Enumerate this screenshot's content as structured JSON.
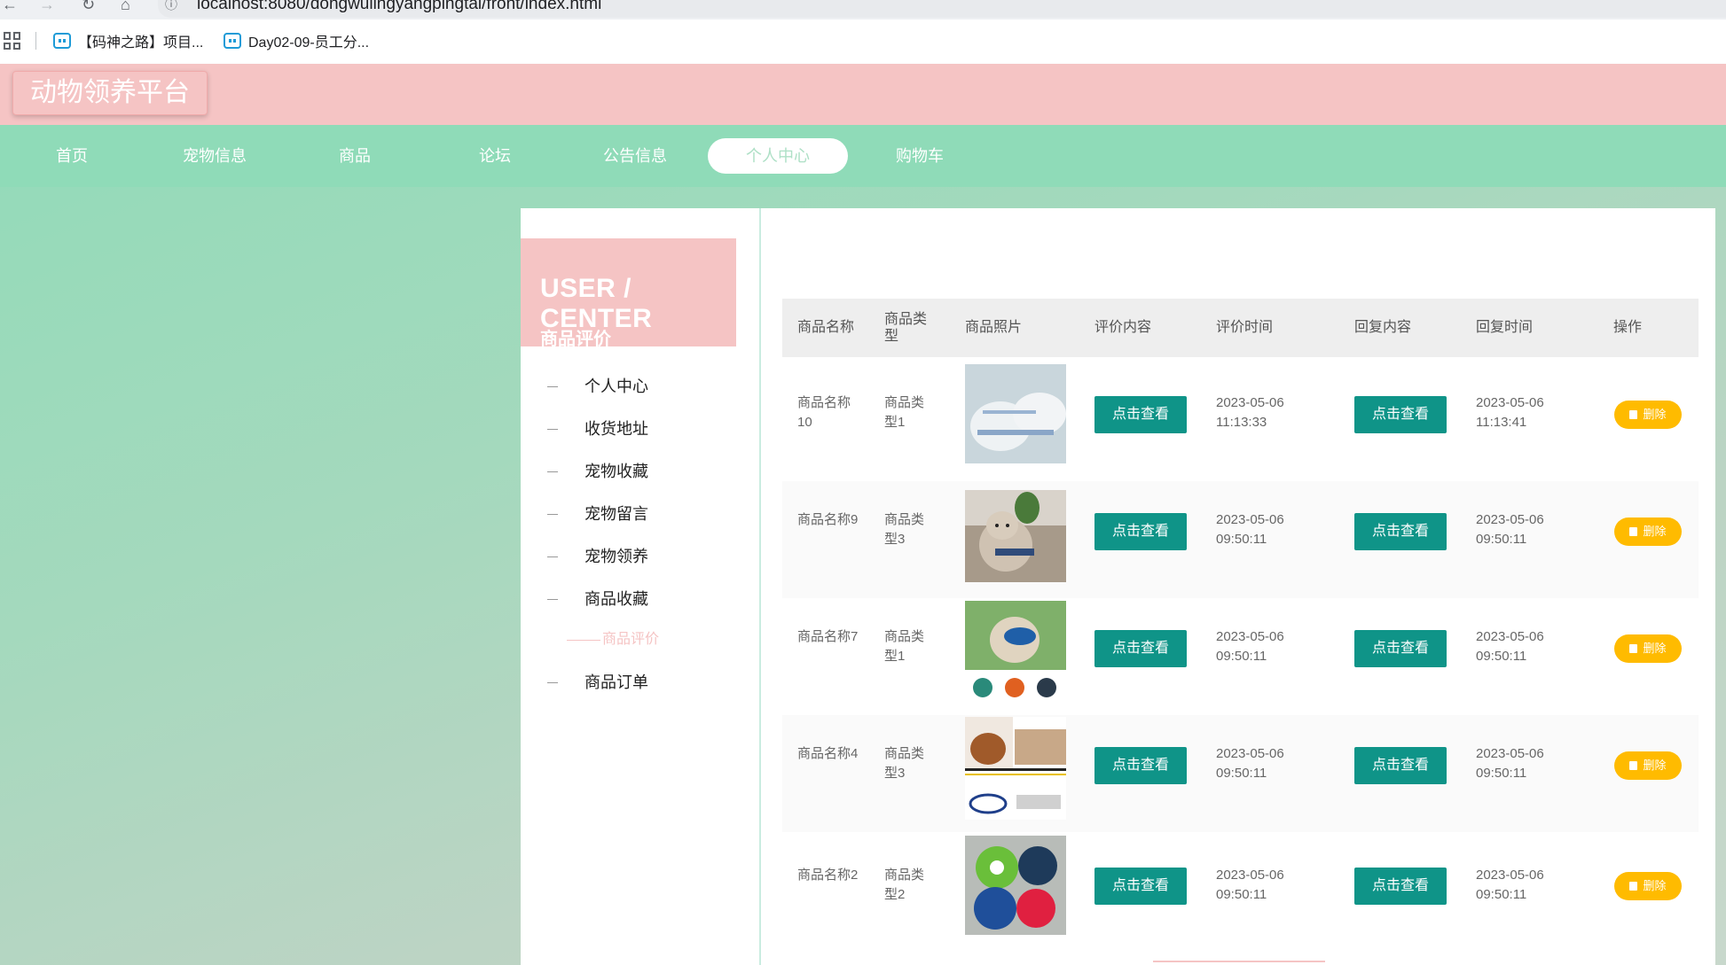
{
  "browser": {
    "url": "localhost:8080/dongwulingyangpingtai/front/index.html",
    "bookmarks": [
      {
        "label": "【码神之路】项目..."
      },
      {
        "label": "Day02-09-员工分..."
      }
    ]
  },
  "site": {
    "logo": "动物领养平台"
  },
  "nav": {
    "items": [
      {
        "label": "首页"
      },
      {
        "label": "宠物信息"
      },
      {
        "label": "商品"
      },
      {
        "label": "论坛"
      },
      {
        "label": "公告信息"
      },
      {
        "label": "个人中心",
        "active": true
      },
      {
        "label": "购物车"
      }
    ]
  },
  "sidebar": {
    "title": "USER / CENTER",
    "subtitle": "商品评价",
    "items": [
      {
        "label": "个人中心"
      },
      {
        "label": "收货地址"
      },
      {
        "label": "宠物收藏"
      },
      {
        "label": "宠物留言"
      },
      {
        "label": "宠物领养"
      },
      {
        "label": "商品收藏"
      },
      {
        "label": "商品评价",
        "active": true
      },
      {
        "label": "商品订单"
      }
    ]
  },
  "table": {
    "headers": [
      "商品名称",
      "商品类型",
      "商品照片",
      "评价内容",
      "评价时间",
      "回复内容",
      "回复时间",
      "操作"
    ],
    "view_label": "点击查看",
    "delete_label": "删除",
    "rows": [
      {
        "name": "商品名称10",
        "type": "商品类型1",
        "eval_time": "2023-05-06 11:13:33",
        "reply_time": "2023-05-06 11:13:41"
      },
      {
        "name": "商品名称9",
        "type": "商品类型3",
        "eval_time": "2023-05-06 09:50:11",
        "reply_time": "2023-05-06 09:50:11"
      },
      {
        "name": "商品名称7",
        "type": "商品类型1",
        "eval_time": "2023-05-06 09:50:11",
        "reply_time": "2023-05-06 09:50:11"
      },
      {
        "name": "商品名称4",
        "type": "商品类型3",
        "eval_time": "2023-05-06 09:50:11",
        "reply_time": "2023-05-06 09:50:11"
      },
      {
        "name": "商品名称2",
        "type": "商品类型2",
        "eval_time": "2023-05-06 09:50:11",
        "reply_time": "2023-05-06 09:50:11"
      }
    ]
  },
  "colors": {
    "header_pink": "#f5c4c4",
    "nav_green": "#8fdbb8",
    "teal_button": "#0f9488",
    "delete_yellow": "#ffbb00"
  }
}
